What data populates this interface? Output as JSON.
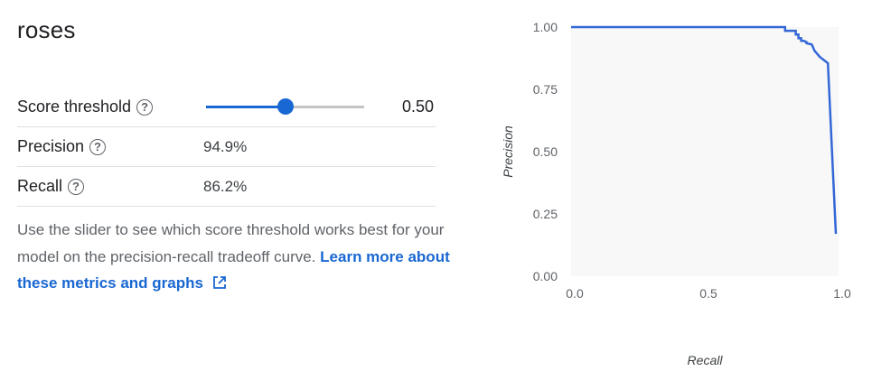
{
  "class_name": "roses",
  "metrics": {
    "score_threshold": {
      "label": "Score threshold",
      "value": "0.50",
      "slider_fraction": 0.5
    },
    "precision": {
      "label": "Precision",
      "value": "94.9%"
    },
    "recall": {
      "label": "Recall",
      "value": "86.2%"
    }
  },
  "description": {
    "text": "Use the slider to see which score threshold works best for your model on the precision-recall tradeoff curve.",
    "link_text": "Learn more about these metrics and graphs"
  },
  "icons": [
    "help-icon",
    "external-link-icon"
  ],
  "colors": {
    "accent": "#1967d2",
    "curve": "#3367d6",
    "plot_bg": "#f8f8f8"
  },
  "chart_data": {
    "type": "line",
    "title": "",
    "xlabel": "Recall",
    "ylabel": "Precision",
    "xlim": [
      0,
      1
    ],
    "ylim": [
      0,
      1
    ],
    "x_ticks": [
      "0.0",
      "0.5",
      "1.0"
    ],
    "y_ticks": [
      "0.00",
      "0.25",
      "0.50",
      "0.75",
      "1.00"
    ],
    "grid": false,
    "series": [
      {
        "x": [
          0.0,
          0.8,
          0.8,
          0.84,
          0.84,
          0.85,
          0.85,
          0.86,
          0.86,
          0.87,
          0.88,
          0.88,
          0.9,
          0.91,
          0.93,
          0.96,
          0.99
        ],
        "y": [
          1.0,
          1.0,
          0.985,
          0.985,
          0.97,
          0.97,
          0.955,
          0.955,
          0.945,
          0.945,
          0.94,
          0.935,
          0.93,
          0.905,
          0.88,
          0.855,
          0.17
        ]
      }
    ]
  }
}
